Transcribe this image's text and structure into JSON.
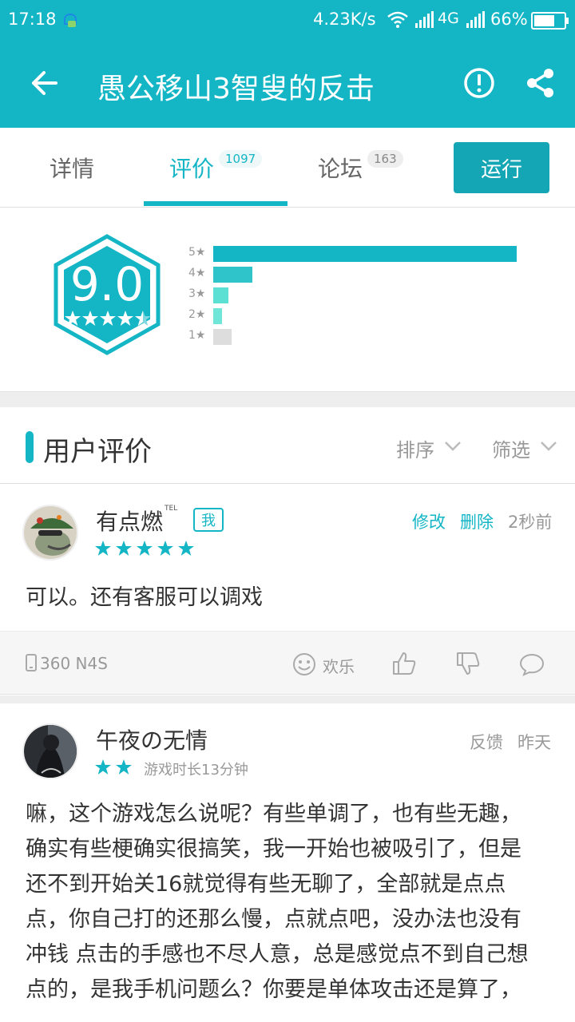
{
  "status_bar": {
    "time": "17:18",
    "net_speed": "4.23K/s",
    "network_type": "4G",
    "battery": "66%"
  },
  "app_bar": {
    "title": "愚公移山3智叟的反击",
    "icons": [
      "back-arrow-icon",
      "report-icon",
      "share-icon"
    ],
    "color": "#14b6c6"
  },
  "tabs": [
    {
      "label": "详情",
      "count": ""
    },
    {
      "label": "评价",
      "count": "1097",
      "active": true
    },
    {
      "label": "论坛",
      "count": "163"
    }
  ],
  "run_button": "运行",
  "rating": {
    "score": "9.0",
    "distribution": [
      {
        "label": "5★",
        "fraction": 1.0,
        "color": "#14b6c6"
      },
      {
        "label": "4★",
        "fraction": 0.13,
        "color": "#2ec4c9"
      },
      {
        "label": "3★",
        "fraction": 0.05,
        "color": "#5ce0d4"
      },
      {
        "label": "2★",
        "fraction": 0.03,
        "color": "#6fe6d8"
      },
      {
        "label": "1★",
        "fraction": 0.06,
        "color": "#dddddd"
      }
    ]
  },
  "reviews_section": {
    "title": "用户评价",
    "sort": "排序",
    "filter": "筛选"
  },
  "review1": {
    "username": "有点燃",
    "tel_mark": "TEL",
    "tag": "我",
    "stars": 5,
    "edit": "修改",
    "delete": "删除",
    "time": "2秒前",
    "text": "可以。还有客服可以调戏",
    "device": "360 N4S",
    "emotion": "欢乐"
  },
  "review2": {
    "username": "午夜の无情",
    "stars": 2,
    "play_time": "游戏时长13分钟",
    "feedback": "反馈",
    "time": "昨天",
    "lines": [
      "嘛，这个游戏怎么说呢？有些单调了，也有些无趣，",
      "确实有些梗确实很搞笑，我一开始也被吸引了，但是",
      "还不到开始关16就觉得有些无聊了，全部就是点点",
      "点，你自己打的还那么慢，点就点吧，没办法也没有",
      "冲钱 点击的手感也不尽人意，总是感觉点不到自己想",
      "点的，是我手机问题么？你要是单体攻击还是算了，"
    ]
  }
}
